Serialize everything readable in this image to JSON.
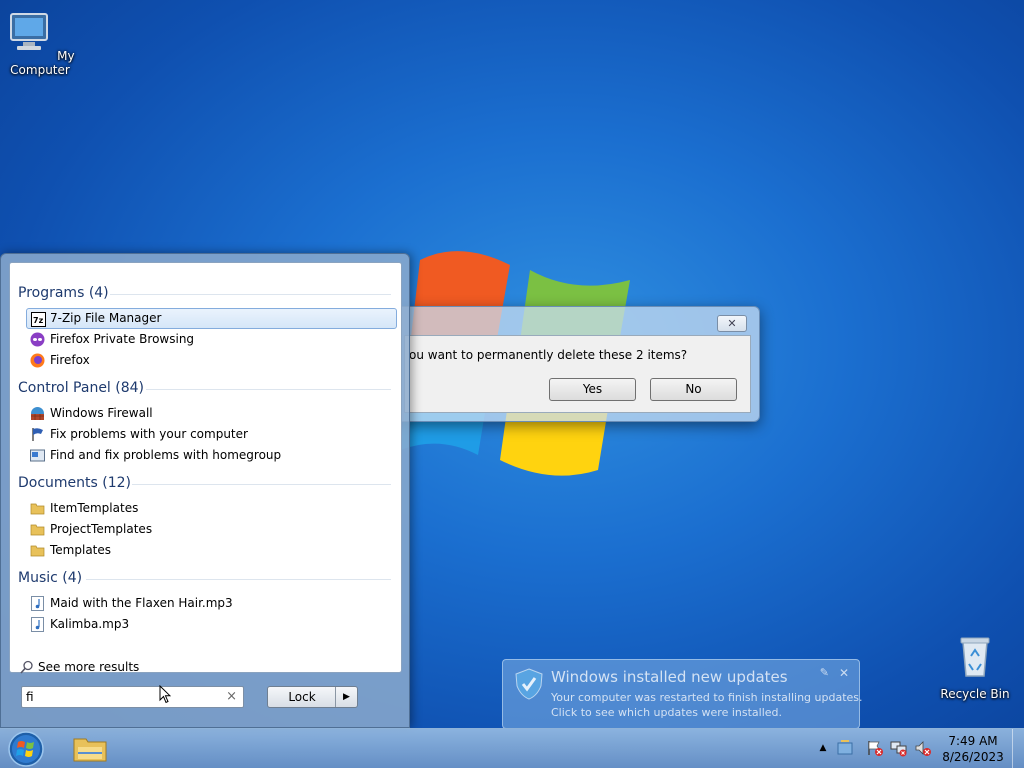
{
  "desktop": {
    "icons": [
      {
        "label": "My Computer",
        "icon": "computer-icon"
      },
      {
        "label": "Recycle Bin",
        "icon": "recycle-bin-icon"
      }
    ]
  },
  "dialog": {
    "message": "ou want to permanently delete these 2 items?",
    "yes_label": "Yes",
    "no_label": "No",
    "close_glyph": "✕"
  },
  "start_menu": {
    "groups": [
      {
        "title": "Programs (4)",
        "items": [
          {
            "label": "7-Zip File Manager",
            "icon": "7zip-icon",
            "selected": true
          },
          {
            "label": "Firefox Private Browsing",
            "icon": "firefox-private-icon"
          },
          {
            "label": "Firefox",
            "icon": "firefox-icon"
          }
        ]
      },
      {
        "title": "Control Panel (84)",
        "items": [
          {
            "label": "Windows Firewall",
            "icon": "firewall-icon"
          },
          {
            "label": "Fix problems with your computer",
            "icon": "action-center-flag-icon"
          },
          {
            "label": "Find and fix problems with homegroup",
            "icon": "troubleshoot-icon"
          }
        ]
      },
      {
        "title": "Documents (12)",
        "items": [
          {
            "label": "ItemTemplates",
            "icon": "folder-icon"
          },
          {
            "label": "ProjectTemplates",
            "icon": "folder-icon"
          },
          {
            "label": "Templates",
            "icon": "folder-icon"
          }
        ]
      },
      {
        "title": "Music (4)",
        "items": [
          {
            "label": "Maid with the Flaxen Hair.mp3",
            "icon": "music-file-icon"
          },
          {
            "label": "Kalimba.mp3",
            "icon": "music-file-icon"
          }
        ]
      }
    ],
    "see_more": "See more results",
    "search_value": "fi",
    "clear_glyph": "×",
    "lock_label": "Lock",
    "lock_arrow": "▶"
  },
  "notification": {
    "title": "Windows installed new updates",
    "line1": "Your computer was restarted to finish installing updates.",
    "line2": "Click to see which updates were installed.",
    "close_glyph": "✕",
    "pin_glyph": "✎"
  },
  "taskbar": {
    "time": "7:49 AM",
    "date": "8/26/2023",
    "tray_expand_glyph": "▲"
  },
  "colors": {
    "desktop_blue": "#1b6fd0",
    "selection_border": "#84acdd",
    "group_title": "#1e3a6e"
  }
}
